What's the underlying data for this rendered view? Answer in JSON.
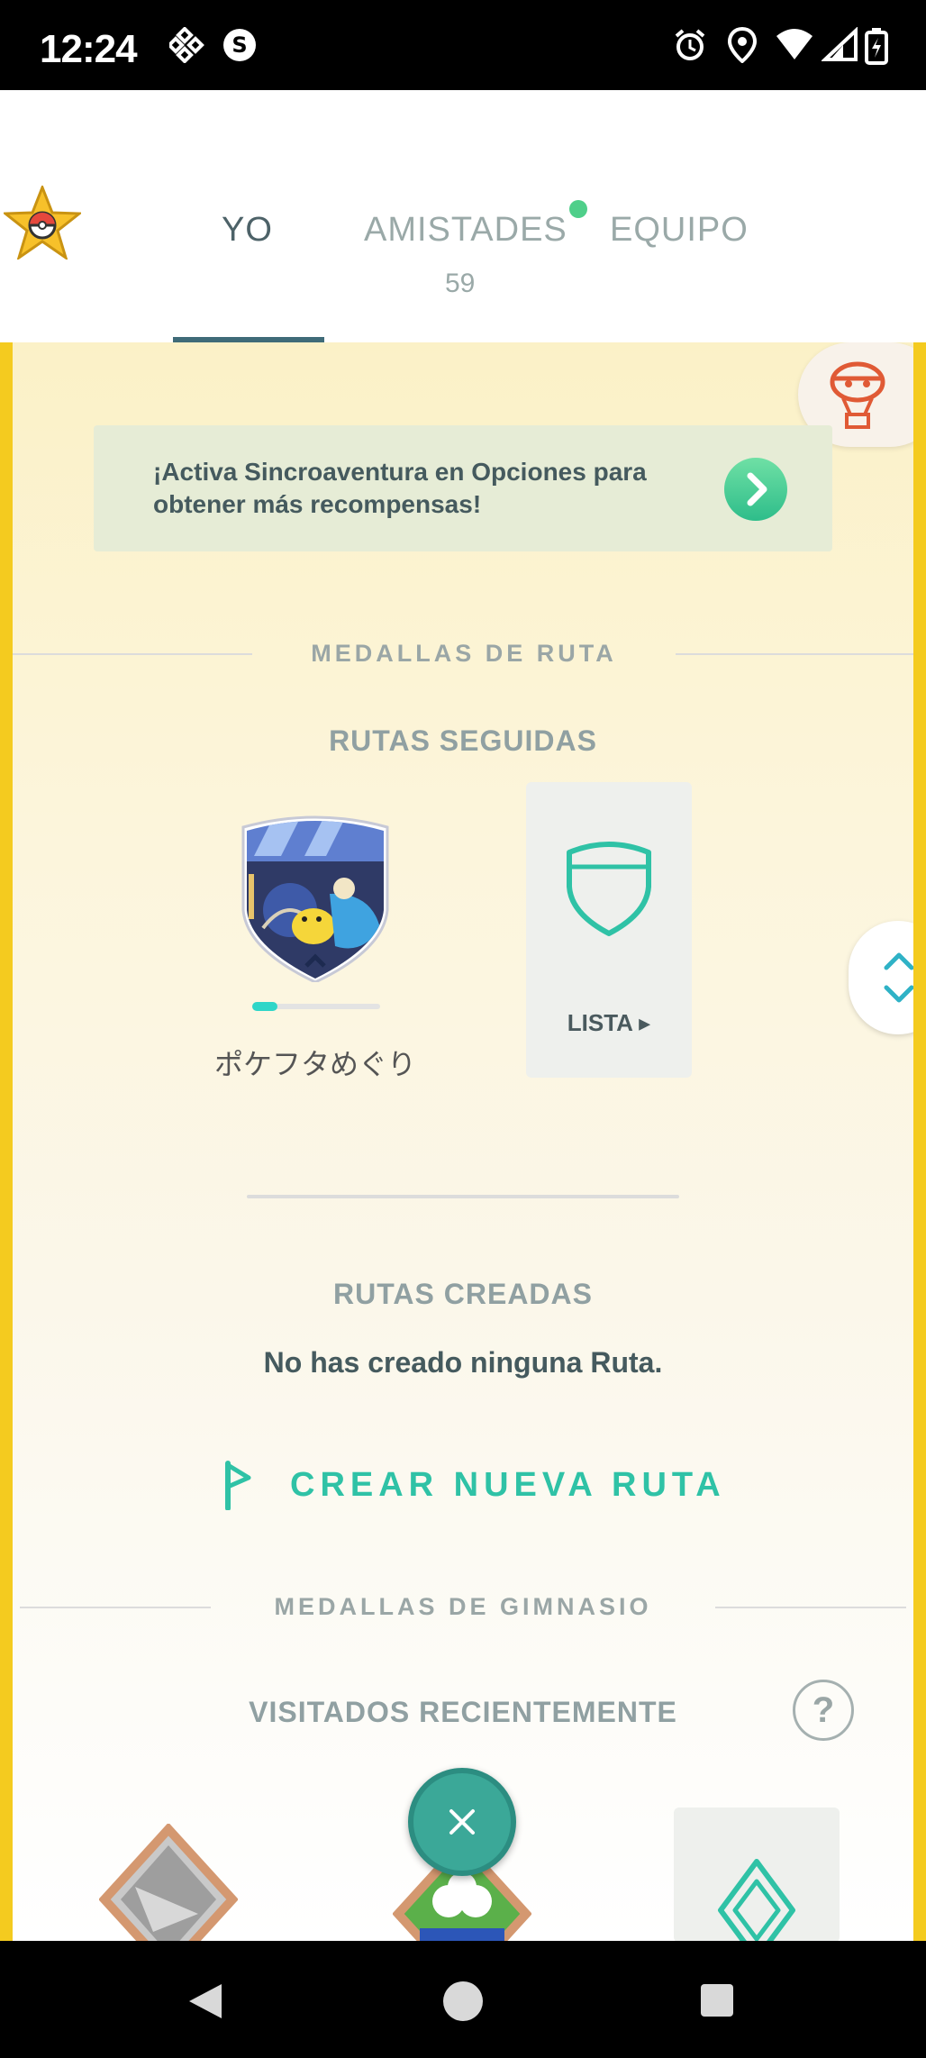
{
  "status_bar": {
    "time": "12:24"
  },
  "tabs": {
    "me": "YO",
    "friends": "AMISTADES",
    "friends_count": "59",
    "team": "EQUIPO"
  },
  "banner": {
    "text": "¡Activa Sincroaventura en Opciones para obtener más recompensas!"
  },
  "route_medals": {
    "section_title": "MEDALLAS DE RUTA",
    "followed_title": "RUTAS SEGUIDAS",
    "followed_routes": [
      {
        "name": "ポケフタめぐり",
        "progress": 0.2
      }
    ],
    "list_label": "LISTA ▸",
    "created_title": "RUTAS CREADAS",
    "no_routes_text": "No has creado ninguna Ruta.",
    "create_button": "CREAR NUEVA RUTA"
  },
  "gym_medals": {
    "section_title": "MEDALLAS DE GIMNASIO",
    "recent_title": "VISITADOS RECIENTEMENTE",
    "help_label": "?"
  },
  "colors": {
    "accent_teal": "#2fc2a6",
    "side_border": "#f4cb1f",
    "fab": "#3ba898"
  }
}
